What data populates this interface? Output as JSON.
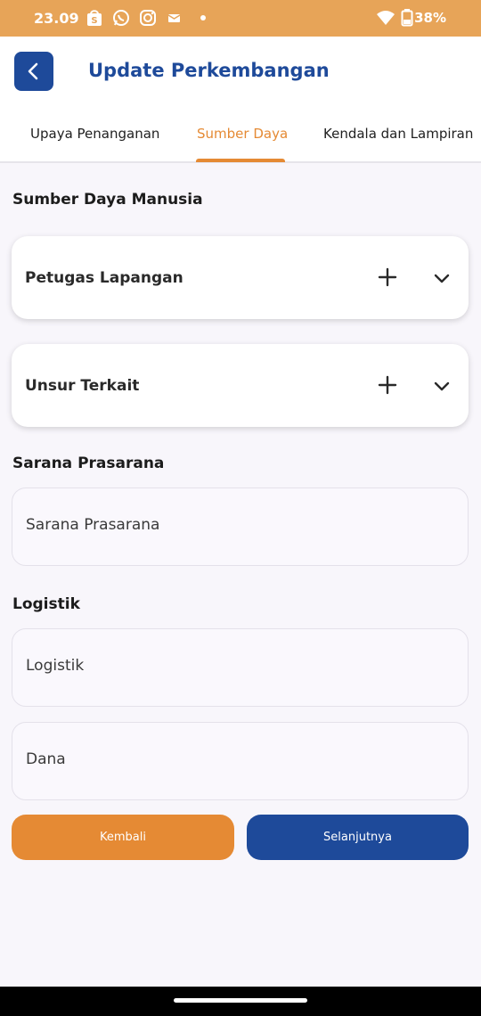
{
  "status_bar": {
    "time": "23.09",
    "battery": "38%",
    "icons": [
      "shopee-icon",
      "whatsapp-icon",
      "instagram-icon",
      "mail-icon",
      "dot-icon",
      "wifi-icon",
      "battery-icon"
    ]
  },
  "header": {
    "title": "Update Perkembangan",
    "back_icon": "chevron-left-icon"
  },
  "tabs": [
    {
      "label": "Upaya Penanganan",
      "active": false
    },
    {
      "label": "Sumber Daya",
      "active": true
    },
    {
      "label": "Kendala dan Lampiran",
      "active": false
    }
  ],
  "sections": {
    "sdm_title": "Sumber Daya Manusia",
    "sarana_title": "Sarana Prasarana",
    "logistik_title": "Logistik"
  },
  "cards": [
    {
      "label": "Petugas Lapangan"
    },
    {
      "label": "Unsur Terkait"
    }
  ],
  "fields": {
    "sarana": {
      "value": "Sarana Prasarana"
    },
    "logistik": {
      "value": "Logistik"
    },
    "dana": {
      "value": "Dana"
    }
  },
  "buttons": {
    "back_label": "Kembali",
    "next_label": "Selanjutnya"
  },
  "colors": {
    "accent_orange": "#e58a34",
    "brand_blue": "#1e4a9a",
    "status_bar": "#e7a458"
  }
}
